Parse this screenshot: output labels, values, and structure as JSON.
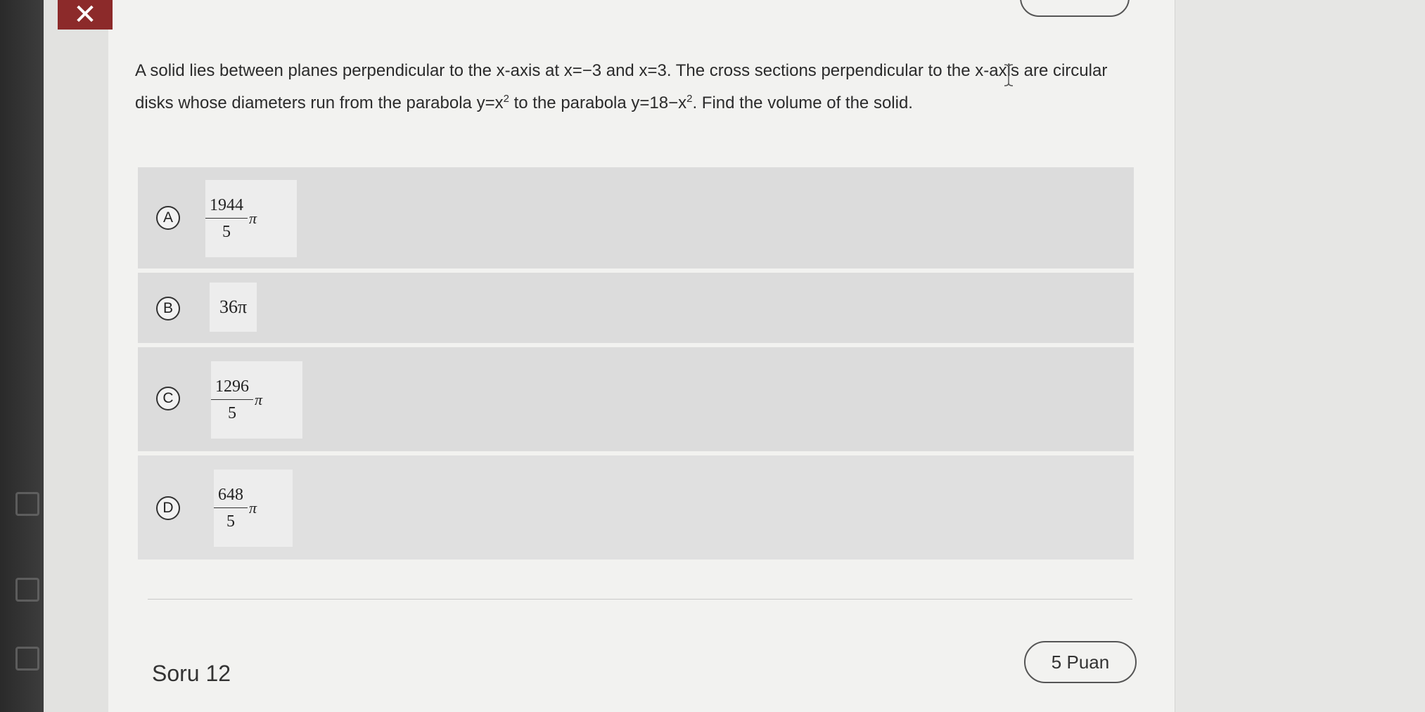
{
  "window": {
    "close_symbol": "✕",
    "sidebar_icons": [
      "calendar-icon",
      "flag-icon",
      "list-icon"
    ]
  },
  "question": {
    "text_part1": "A solid lies between planes perpendicular to the x-axis at x=−3 and x=3. The cross sections perpendicular to the x-axis are circular disks whose diameters run from the parabola y=x",
    "sup1": "2",
    "text_part2": " to the parabola y=18−x",
    "sup2": "2",
    "text_part3": ". Find the volume of the solid."
  },
  "options": [
    {
      "letter": "A",
      "numerator": "1944",
      "denominator": "5",
      "suffix": "π"
    },
    {
      "letter": "B",
      "value": "36π"
    },
    {
      "letter": "C",
      "numerator": "1296",
      "denominator": "5",
      "suffix": "π"
    },
    {
      "letter": "D",
      "numerator": "648",
      "denominator": "5",
      "suffix": "π"
    }
  ],
  "footer": {
    "next_question_label": "Soru 12",
    "points_label": "5 Puan"
  },
  "colors": {
    "close_button": "#8c2a2a",
    "option_background": "#dcdcdc",
    "page_background": "#f2f2f0"
  }
}
